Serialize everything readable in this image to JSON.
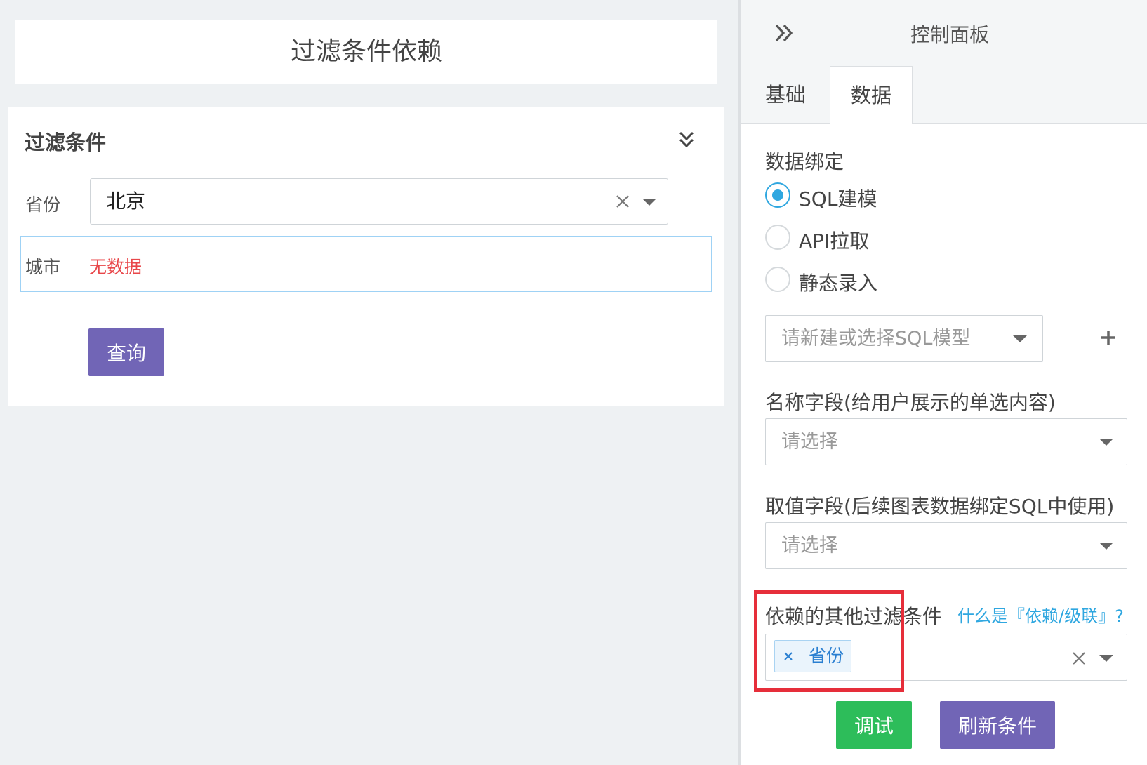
{
  "left": {
    "page_title": "过滤条件依赖",
    "filter_card": {
      "title": "过滤条件",
      "province_label": "省份",
      "province_value": "北京",
      "city_label": "城市",
      "city_empty_text": "无数据",
      "query_button": "查询"
    }
  },
  "panel": {
    "title": "控制面板",
    "tabs": [
      {
        "label": "基础",
        "active": false
      },
      {
        "label": "数据",
        "active": true
      }
    ],
    "data_binding": {
      "label": "数据绑定",
      "options": [
        {
          "label": "SQL建模",
          "selected": true
        },
        {
          "label": "API拉取",
          "selected": false
        },
        {
          "label": "静态录入",
          "selected": false
        }
      ],
      "sql_model_placeholder": "请新建或选择SQL模型"
    },
    "name_field": {
      "label": "名称字段(给用户展示的单选内容)",
      "placeholder": "请选择"
    },
    "value_field": {
      "label": "取值字段(后续图表数据绑定SQL中使用)",
      "placeholder": "请选择"
    },
    "dependency": {
      "label": "依赖的其他过滤条件",
      "help_link": "什么是『依赖/级联』?",
      "selected_tags": [
        "省份"
      ]
    },
    "debug_button": "调试",
    "refresh_button": "刷新条件"
  },
  "colors": {
    "primary_purple": "#7165b6",
    "success_green": "#2dbd5a",
    "accent_blue": "#2fa7e0",
    "error_red": "#e8474a",
    "highlight_red": "#e62e3a"
  },
  "icons": {
    "collapse": "double-chevron-down-icon",
    "expand_panel": "double-chevron-right-icon",
    "clear": "close-icon",
    "dropdown": "caret-down-icon",
    "add": "plus-icon"
  }
}
